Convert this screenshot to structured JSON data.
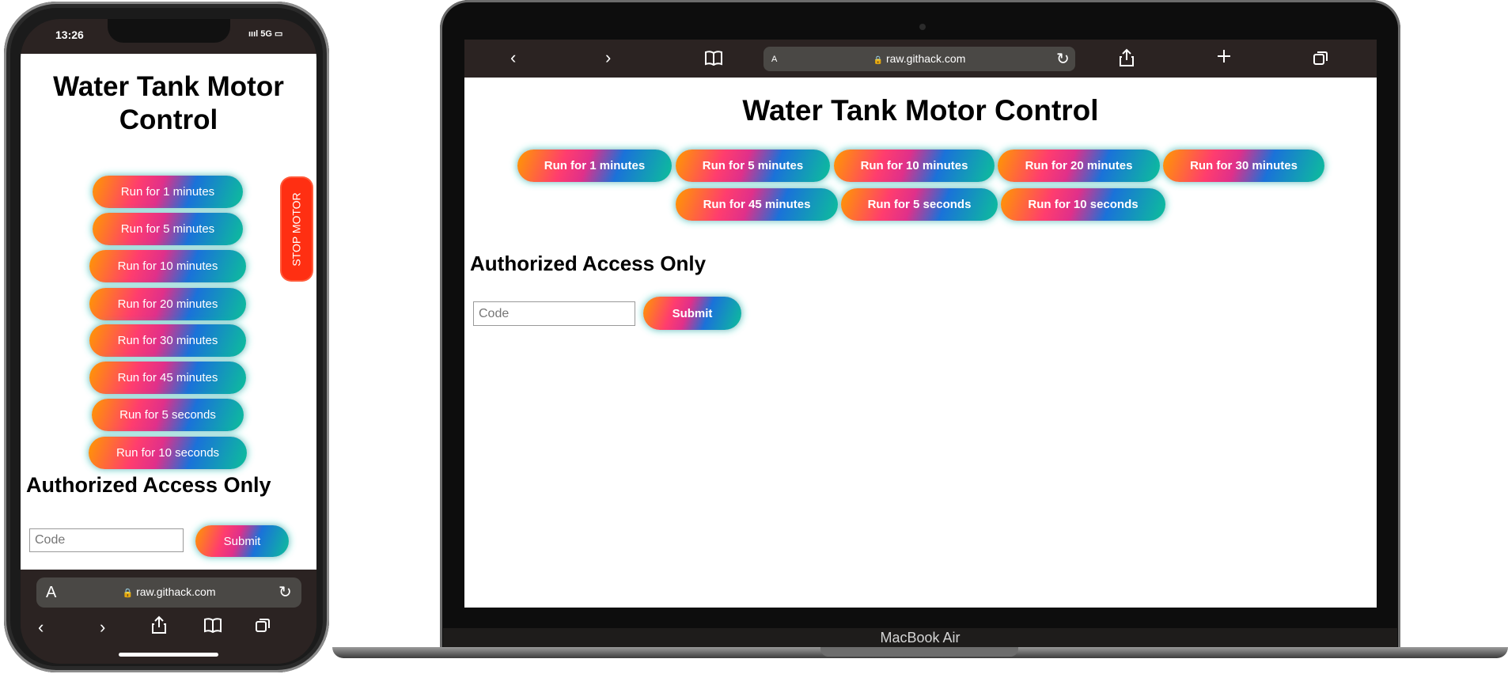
{
  "phone": {
    "time": "13:26",
    "status_right": "ıııl 5G ▭",
    "title": "Water Tank Motor Control",
    "buttons": [
      "Run for 1 minutes",
      "Run for 5 minutes",
      "Run for 10 minutes",
      "Run for 20 minutes",
      "Run for 30 minutes",
      "Run for 45 minutes",
      "Run for 5 seconds",
      "Run for 10 seconds"
    ],
    "stop_label": "STOP MOTOR",
    "auth_title": "Authorized Access Only",
    "code_placeholder": "Code",
    "submit_label": "Submit",
    "url_a": "A",
    "url": "raw.githack.com"
  },
  "laptop": {
    "url_a": "A",
    "url": "raw.githack.com",
    "title": "Water Tank Motor Control",
    "buttons": [
      "Run for 1 minutes",
      "Run for 5 minutes",
      "Run for 10 minutes",
      "Run for 20 minutes",
      "Run for 30 minutes",
      "Run for 45 minutes",
      "Run for 5 seconds",
      "Run for 10 seconds"
    ],
    "auth_title": "Authorized Access Only",
    "code_placeholder": "Code",
    "submit_label": "Submit",
    "brand": "MacBook Air"
  },
  "icons": {
    "back": "‹",
    "forward": "›",
    "reload": "↻",
    "lock": "🔒"
  }
}
